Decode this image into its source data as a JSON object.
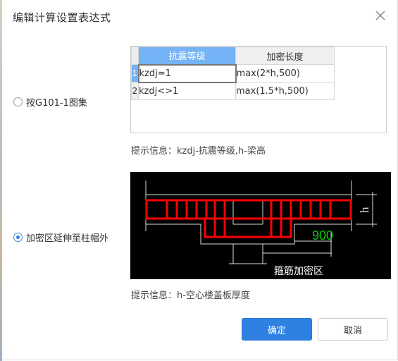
{
  "dialog": {
    "title": "编辑计算设置表达式",
    "close_icon": "close-icon"
  },
  "options": [
    {
      "label": "按G101-1图集",
      "selected": false
    },
    {
      "label": "加密区延伸至柱帽外",
      "selected": true
    }
  ],
  "grid": {
    "headers": [
      "抗震等级",
      "加密长度"
    ],
    "rows": [
      {
        "no": "1",
        "grade": "kzdj=1",
        "length": "max(2*h,500)"
      },
      {
        "no": "2",
        "grade": "kzdj<>1",
        "length": "max(1.5*h,500)"
      }
    ]
  },
  "hints": {
    "grid_hint": "提示信息：kzdj-抗震等级,h-梁高",
    "diagram_hint": "提示信息：h-空心楼盖板厚度"
  },
  "diagram": {
    "dimension_label": "900",
    "height_label": "h",
    "zone_label": "箍筋加密区",
    "rebar_color": "#ff0000",
    "dimension_color": "#00d000"
  },
  "buttons": {
    "ok": "确定",
    "cancel": "取消"
  },
  "colors": {
    "accent": "#2f81e1",
    "header_selected": "#74b3f5"
  }
}
